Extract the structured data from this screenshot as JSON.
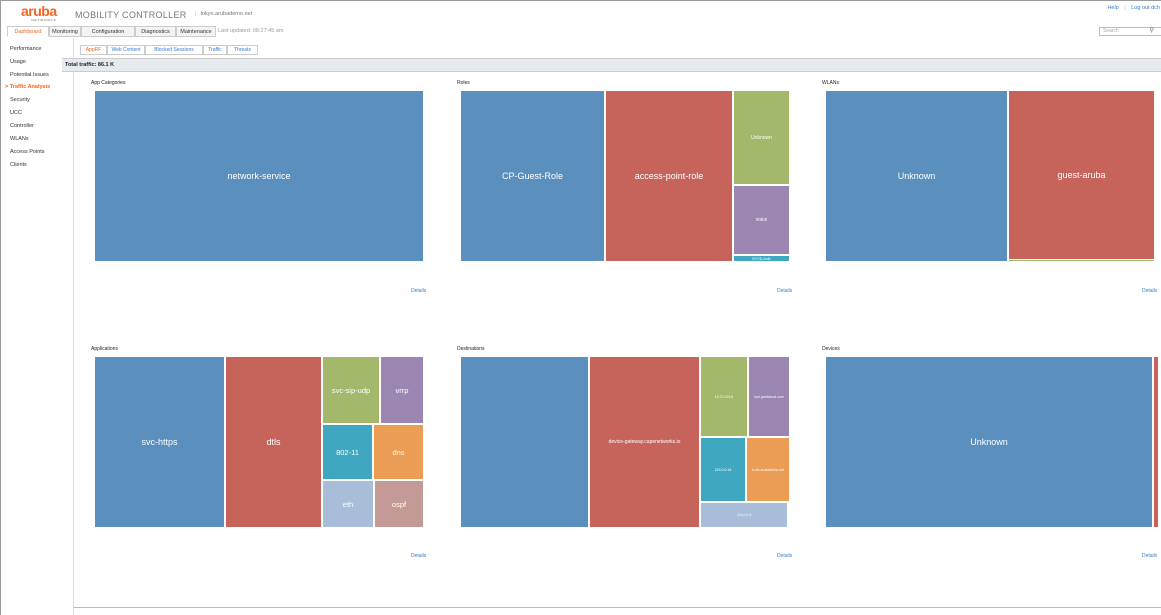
{
  "header": {
    "logo_text": "aruba",
    "logo_sub": "NETWORKS",
    "product": "MOBILITY CONTROLLER",
    "separator": "|",
    "host": "tokyo.arubademo.net",
    "help": "Help",
    "divider": "|",
    "logout": "Log out dch"
  },
  "nav": {
    "tabs": [
      "Dashboard",
      "Monitoring",
      "Configuration",
      "Diagnostics",
      "Maintenance"
    ],
    "active": "Dashboard",
    "last_updated": "Last updated: 08:27:45 am",
    "search_placeholder": "Search"
  },
  "sidebar": {
    "items": [
      "Performance",
      "Usage",
      "Potential Issues",
      "Traffic Analysis",
      "Security",
      "UCC",
      "Controller",
      "WLANs",
      "Access Points",
      "Clients"
    ],
    "active": "Traffic Analysis",
    "active_marker": ">"
  },
  "subtabs": {
    "items": [
      "AppRF",
      "Web Content",
      "Blocked Sessions",
      "Traffic",
      "Threats"
    ],
    "active": "AppRF"
  },
  "total_traffic": "Total traffic: 86.1 K",
  "details_label": "Details",
  "panels": {
    "app_categories": {
      "title": "App Categories",
      "tiles": [
        {
          "label": "network-service",
          "color": "#5a8fbe"
        }
      ]
    },
    "roles": {
      "title": "Roles",
      "tiles": [
        {
          "label": "CP-Guest-Role",
          "color": "#5a8fbe"
        },
        {
          "label": "access-point-role",
          "color": "#c6635b"
        },
        {
          "label": "Unknown",
          "color": "#a3b86b"
        },
        {
          "label": "voice",
          "color": "#9a86b0"
        },
        {
          "label": "BYOD-Auth",
          "color": "#3fa8c0"
        }
      ]
    },
    "wlans": {
      "title": "WLANs",
      "tiles": [
        {
          "label": "Unknown",
          "color": "#5a8fbe"
        },
        {
          "label": "guest-aruba",
          "color": "#c6635b"
        },
        {
          "label": "",
          "color": "#a3b86b"
        }
      ]
    },
    "applications": {
      "title": "Applications",
      "tiles": [
        {
          "label": "svc-https",
          "color": "#5a8fbe"
        },
        {
          "label": "dtls",
          "color": "#c6635b"
        },
        {
          "label": "svc-sip-udp",
          "color": "#a3b86b"
        },
        {
          "label": "vrrp",
          "color": "#9a86b0"
        },
        {
          "label": "802-11",
          "color": "#3fa8c0"
        },
        {
          "label": "dns",
          "color": "#eb9c55"
        },
        {
          "label": "eth",
          "color": "#a8bdd8"
        },
        {
          "label": "ospf",
          "color": "#c49a96"
        }
      ]
    },
    "destinations": {
      "title": "Destinations",
      "tiles": [
        {
          "label": "",
          "color": "#5a8fbe"
        },
        {
          "label": "device-gateway.capenetworks.io",
          "color": "#c6635b"
        },
        {
          "label": "10.70.219.6",
          "color": "#a3b86b"
        },
        {
          "label": "hpe.jamfcloud.com",
          "color": "#9a86b0"
        },
        {
          "label": "224.0.0.18",
          "color": "#3fa8c0"
        },
        {
          "label": "b-ufc.arubademo.net",
          "color": "#eb9c55"
        },
        {
          "label": "224.0.0.5",
          "color": "#a8bdd8"
        }
      ]
    },
    "devices": {
      "title": "Devices",
      "tiles": [
        {
          "label": "Unknown",
          "color": "#5a8fbe"
        },
        {
          "label": "",
          "color": "#c6635b"
        }
      ]
    }
  }
}
